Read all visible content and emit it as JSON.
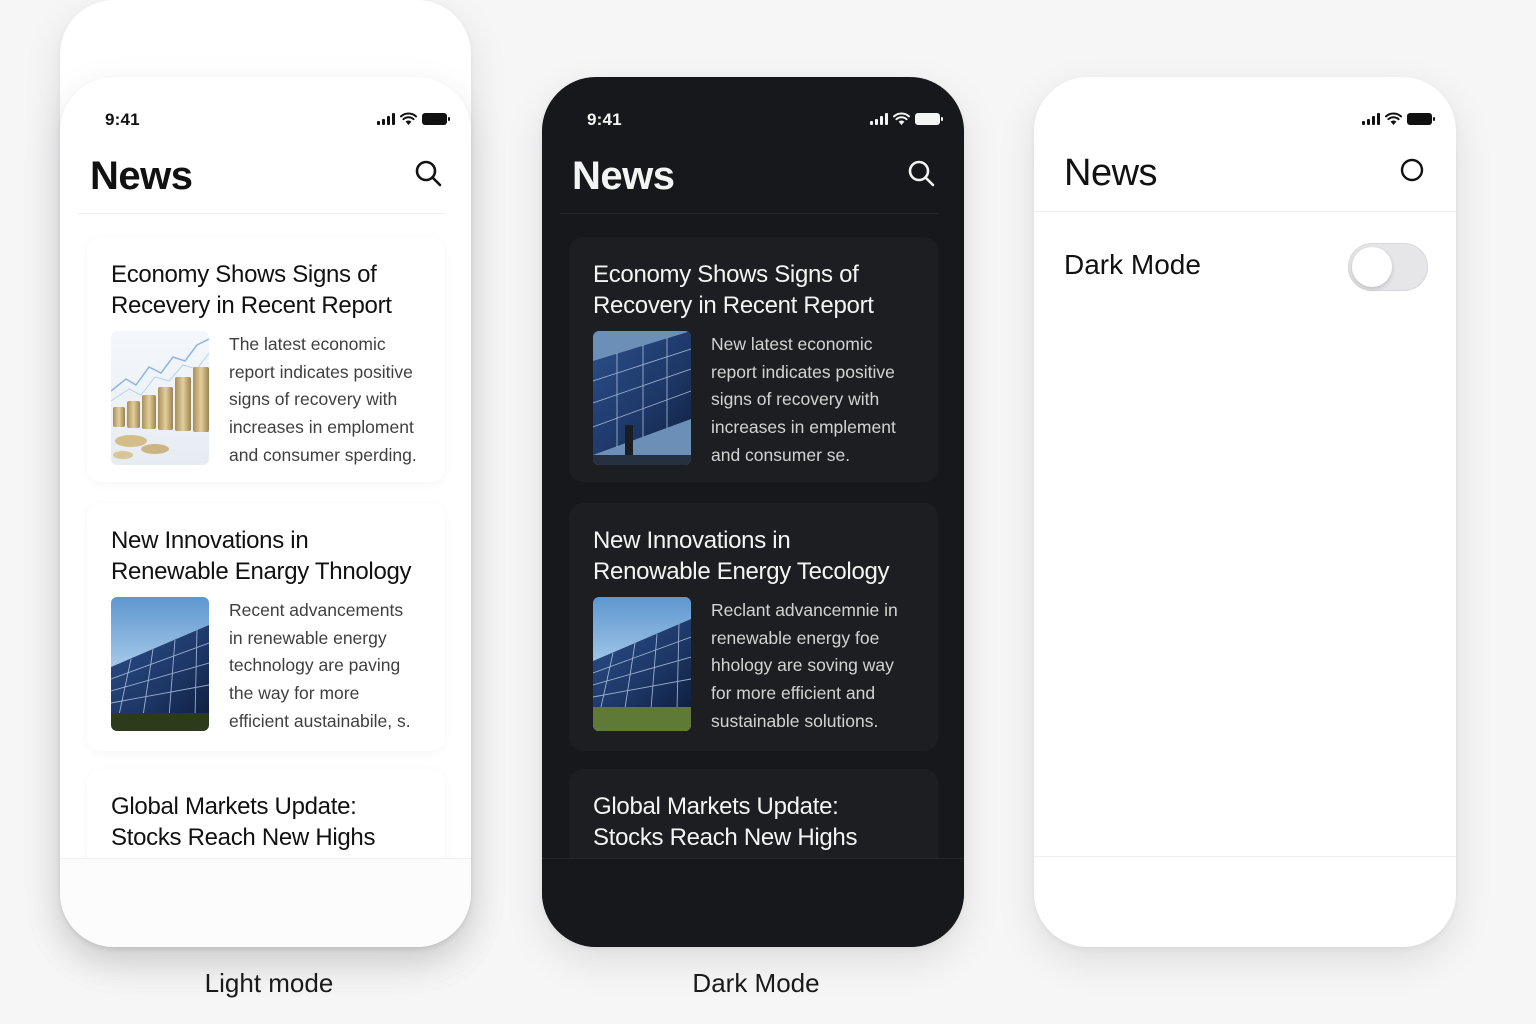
{
  "status_bar": {
    "time": "9:41"
  },
  "light_phone": {
    "header": {
      "title": "News"
    },
    "articles": [
      {
        "headline": "Economy Shows Signs of Recevery in Recent Report",
        "summary": "The latest economic report indicates positive signs of recovery with increases in emploment and consumer sperding.",
        "image": "coins-chart-photo"
      },
      {
        "headline": "New Innovations in Renewable Enargy Thnology",
        "summary": "Recent advancements in renewable energy technology are paving the way for more efficient austainabile, s.",
        "image": "solar-panel-photo"
      },
      {
        "headline": "Global Markets Update: Stocks Reach New Highs"
      }
    ],
    "caption": "Light mode"
  },
  "dark_phone": {
    "header": {
      "title": "News"
    },
    "articles": [
      {
        "headline": "Economy Shows Signs of Recovery in Recent Report",
        "summary": "New latest economic report indicates positive signs of recovery with increases in emplement and consumer se.",
        "image": "solar-panel-photo"
      },
      {
        "headline": "New Innovations in Renowable Energy Tecology",
        "summary": "Reclant advancemnie in renewable energy foe hhology are soving way for more efficient and sustainable solutions.",
        "image": "solar-panel-photo"
      },
      {
        "headline": "Global Markets Update: Stocks Reach New Highs"
      }
    ],
    "caption": "Dark Mode"
  },
  "settings_phone": {
    "header": {
      "title": "News"
    },
    "dark_mode_label": "Dark Mode",
    "dark_mode_enabled": false
  },
  "colors": {
    "background": "#f6f6f7",
    "dark_surface": "#17181b",
    "dark_card": "#1d1e22",
    "light_text": "#111111"
  }
}
